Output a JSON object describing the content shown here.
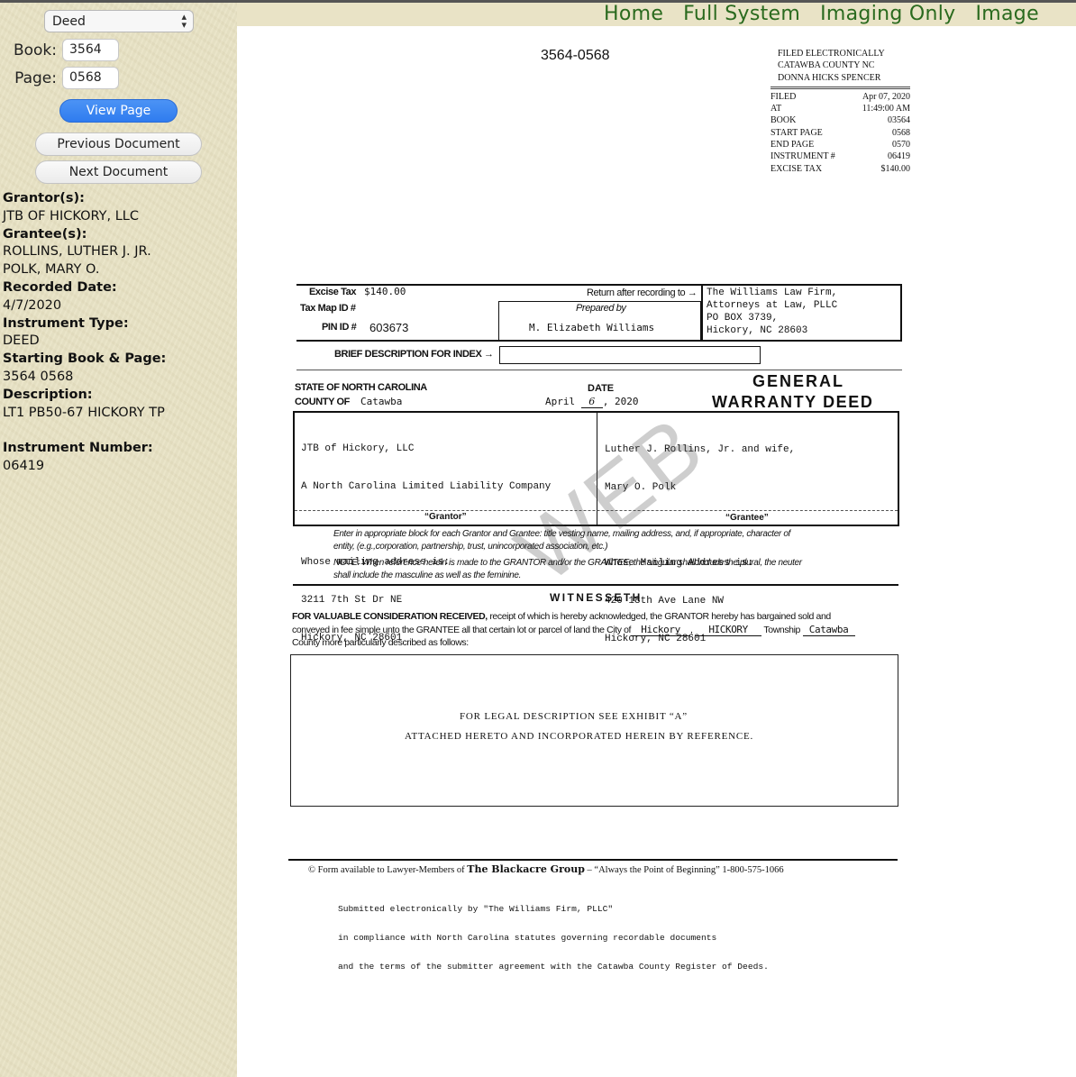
{
  "nav": {
    "items": [
      "Home",
      "Full System",
      "Imaging Only",
      "Image"
    ]
  },
  "sidebar": {
    "doc_type": "Deed",
    "book_label": "Book:",
    "book_value": "3564",
    "page_label": "Page:",
    "page_value": "0568",
    "view_button": "View Page",
    "prev_button": "Previous Document",
    "next_button": "Next Document",
    "grantor_label": "Grantor(s):",
    "grantor_1": "JTB OF HICKORY, LLC",
    "grantee_label": "Grantee(s):",
    "grantee_1": "ROLLINS, LUTHER J. JR.",
    "grantee_2": "POLK, MARY O.",
    "recorded_label": "Recorded Date:",
    "recorded_value": "4/7/2020",
    "type_label": "Instrument Type:",
    "type_value": "DEED",
    "bookpage_label": "Starting Book & Page:",
    "bookpage_value": "3564 0568",
    "desc_label": "Description:",
    "desc_value": "LT1 PB50-67 HICKORY TP",
    "instnum_label": "Instrument Number:",
    "instnum_value": "06419"
  },
  "document": {
    "header_id": "3564-0568",
    "stamp": {
      "line1": "FILED ELECTRONICALLY",
      "line2": "CATAWBA COUNTY NC",
      "line3": "DONNA HICKS SPENCER",
      "rows": [
        {
          "k": "FILED",
          "v": "Apr 07, 2020"
        },
        {
          "k": "AT",
          "v": "11:49:00 AM"
        },
        {
          "k": "BOOK",
          "v": "03564"
        },
        {
          "k": "START PAGE",
          "v": "0568"
        },
        {
          "k": "END PAGE",
          "v": "0570"
        },
        {
          "k": "INSTRUMENT #",
          "v": "06419"
        },
        {
          "k": "EXCISE TAX",
          "v": "$140.00"
        }
      ]
    },
    "excise_label": "Excise Tax",
    "excise_value": "$140.00",
    "taxmap_label": "Tax Map ID #",
    "pin_label": "PIN ID #",
    "pin_value": "603673",
    "return_label": "Return after recording to",
    "return_addr": [
      "The Williams Law Firm,",
      "Attorneys at Law, PLLC",
      "PO BOX 3739,",
      "Hickory, NC 28603"
    ],
    "prepared_label": "Prepared by",
    "prepared_value": "M. Elizabeth Williams",
    "brief_label": "BRIEF DESCRIPTION FOR INDEX",
    "state_label": "STATE OF NORTH CAROLINA",
    "county_label": "COUNTY OF",
    "county_value": "Catawba",
    "date_label": "DATE",
    "date_month": "April",
    "date_day": "6",
    "date_year": ", 2020",
    "title_1": "GENERAL",
    "title_2": "WARRANTY DEED",
    "grantor_lines": [
      "JTB of Hickory, LLC",
      "A North Carolina Limited Liability Company",
      "",
      "Whose mailing address is:",
      "3211 7th St Dr NE",
      "Hickory, NC 28601"
    ],
    "grantee_lines": [
      "Luther J. Rollins, Jr. and wife,",
      "Mary O. Polk",
      "",
      "Whose Mailing Address is:",
      "420 18th Ave Lane NW",
      "Hickory, NC 28601"
    ],
    "grantor_caption": "“Grantor”",
    "grantee_caption": "“Grantee”",
    "instr_1": "Enter in appropriate block for each Grantor and Grantee: title vesting name, mailing address, and, if appropriate, character of",
    "instr_2": "entity, (e.g.,corporation, partnership, trust, unincorporated association, etc.)",
    "note_1": "NOTE: When reference herein is made to the GRANTOR and/or the GRANTEE, the singular shall include the plural, the neuter",
    "note_2": "shall include the masculine as well as the feminine.",
    "witnesseth": "WITNESSETH",
    "consid_1a": "FOR VALUABLE CONSIDERATION RECEIVED,",
    "consid_1b": " receipt of which is hereby acknowledged, the GRANTOR hereby has bargained sold and",
    "consid_2": "conveyed in fee simple unto the GRANTEE all that certain lot or parcel of land the City of",
    "city_value": "Hickory",
    "township_value": "HICKORY",
    "township_label": "Township",
    "county2_value": "Catawba",
    "consid_3": "County more particularly described as follows:",
    "legal_1": "FOR LEGAL DESCRIPTION SEE EXHIBIT “A”",
    "legal_2": "ATTACHED HERETO AND INCORPORATED HEREIN BY REFERENCE.",
    "footer_form_a": "© Form available to Lawyer-Members of",
    "footer_form_b": "The Blackacre Group",
    "footer_form_c": "– “Always the Point of Beginning”  1-800-575-1066",
    "submit_1": "Submitted electronically by \"The Williams Firm, PLLC\"",
    "submit_2": "in compliance with North Carolina statutes governing recordable documents",
    "submit_3": "and the terms of the submitter agreement with the Catawba County Register of Deeds.",
    "watermark": "WEB"
  }
}
